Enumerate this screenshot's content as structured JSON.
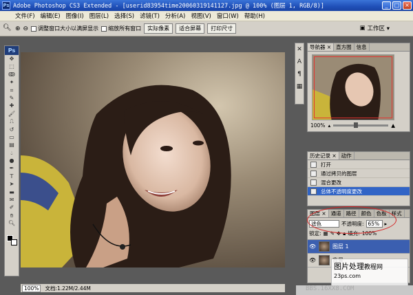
{
  "titlebar": {
    "app_icon": "Ps",
    "title": "Adobe Photoshop CS3 Extended - [userid83954time20060319141127.jpg @ 100% (图层 1, RGB/8)]",
    "buttons": [
      "_",
      "□",
      "×"
    ]
  },
  "menubar": {
    "items": [
      "文件(F)",
      "编辑(E)",
      "图像(I)",
      "图层(L)",
      "选择(S)",
      "滤镜(T)",
      "分析(A)",
      "视图(V)",
      "窗口(W)",
      "帮助(H)"
    ]
  },
  "options": {
    "resize_windows": "调整窗口大小以满屏显示",
    "zoom_all": "缩放所有窗口",
    "actual_pixels": "实际像素",
    "fit_screen": "适合屏幕",
    "print_size": "打印尺寸",
    "workspace": "工作区 ▾"
  },
  "toolbox": {
    "logo": "Ps"
  },
  "status": {
    "zoom": "100%",
    "doc": "文档:1.22M/2.44M"
  },
  "navigator": {
    "tabs": [
      "导航器 ×",
      "直方图",
      "信息"
    ],
    "zoom": "100%"
  },
  "history": {
    "tabs": [
      "历史记录 ×",
      "动作"
    ],
    "items": [
      "打开",
      "通过拷贝的图层",
      "混合更改",
      "总体不透明度更改"
    ],
    "selected_index": 3
  },
  "layers": {
    "tabs": [
      "图层 ×",
      "通道",
      "路径",
      "颜色",
      "色板",
      "样式"
    ],
    "blend_mode": "滤色",
    "opacity_label": "不透明度:",
    "opacity": "65%",
    "lock_label": "锁定:",
    "fill_label": "填充:",
    "fill": "100%",
    "rows": [
      {
        "name": "图层 1",
        "selected": true
      },
      {
        "name": "背景",
        "selected": false
      }
    ]
  },
  "watermark": {
    "line1": "图片处理",
    "line1b": "教程网",
    "line2": "23ps.com"
  },
  "bottom": {
    "text": "BBS.16XX8.COM"
  },
  "colors": {
    "titlebar": "#1f4fb8",
    "selection": "#3164c6",
    "highlight_ellipse": "#d42020"
  }
}
